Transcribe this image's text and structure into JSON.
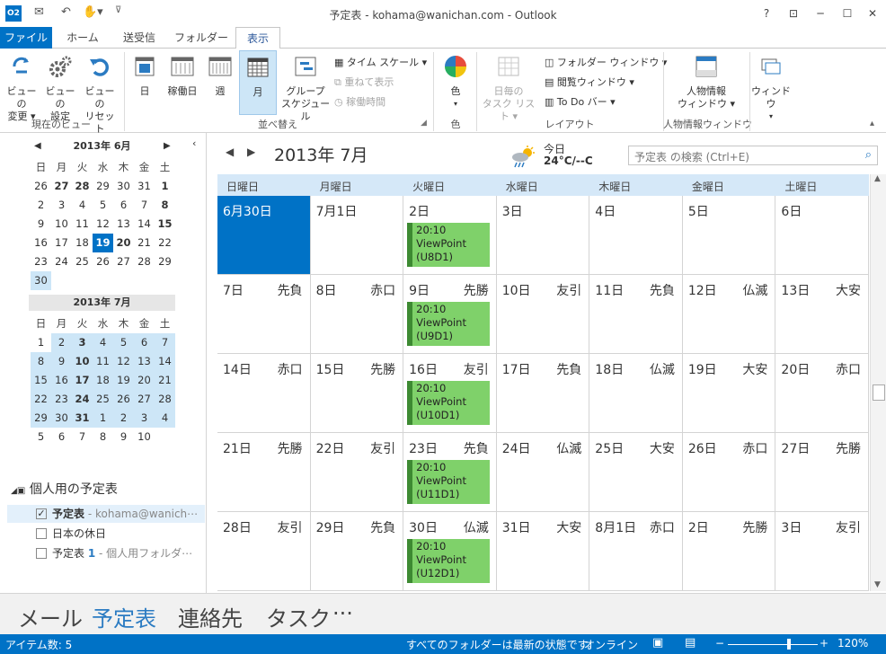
{
  "window": {
    "title": "予定表 - kohama@wanichan.com - Outlook",
    "app_icon": "O2",
    "help": "?",
    "restore_ribbon": "⊡",
    "minimize": "─",
    "maximize": "☐",
    "close": "✕",
    "qat_customize": "⊽"
  },
  "tabs": [
    "ファイル",
    "ホーム",
    "送受信",
    "フォルダー",
    "表示"
  ],
  "ribbon": {
    "current_view": {
      "label": "現在のビュー",
      "change": [
        "ビューの",
        "変更 ▾"
      ],
      "settings": [
        "ビューの",
        "設定"
      ],
      "reset": [
        "ビューの",
        "リセット"
      ]
    },
    "arrange": {
      "label": "並べ替え",
      "day": "日",
      "work_week": "稼働日",
      "week": "週",
      "month": "月",
      "schedule": [
        "グループ",
        "スケジュール"
      ],
      "time_scale": "タイム スケール ▾",
      "overlay": "重ねて表示",
      "working_hours": "稼働時間"
    },
    "color": {
      "label": "色",
      "btn": "色"
    },
    "layout": {
      "label": "レイアウト",
      "daily_task": [
        "日毎の",
        "タスク リスト ▾"
      ],
      "folder_pane": "フォルダー ウィンドウ ▾",
      "reading_pane": "閲覧ウィンドウ ▾",
      "todo_bar": "To Do バー ▾"
    },
    "people": {
      "label": "人物情報ウィンドウ",
      "btn": [
        "人物情報",
        "ウィンドウ ▾"
      ]
    },
    "window": {
      "btn": "ウィンドウ"
    }
  },
  "mini_cal": {
    "dow": [
      "日",
      "月",
      "火",
      "水",
      "木",
      "金",
      "土"
    ],
    "june": {
      "title": "2013年 6月",
      "days": [
        "26",
        "27",
        "28",
        "29",
        "30",
        "31",
        "1",
        "2",
        "3",
        "4",
        "5",
        "6",
        "7",
        "8",
        "9",
        "10",
        "11",
        "12",
        "13",
        "14",
        "15",
        "16",
        "17",
        "18",
        "19",
        "20",
        "21",
        "22",
        "23",
        "24",
        "25",
        "26",
        "27",
        "28",
        "29",
        "30"
      ]
    },
    "july": {
      "title": "2013年 7月",
      "days": [
        "1",
        "2",
        "3",
        "4",
        "5",
        "6",
        "7",
        "8",
        "9",
        "10",
        "11",
        "12",
        "13",
        "14",
        "15",
        "16",
        "17",
        "18",
        "19",
        "20",
        "21",
        "22",
        "23",
        "24",
        "25",
        "26",
        "27",
        "28",
        "29",
        "30",
        "31",
        "1",
        "2",
        "3",
        "4",
        "5",
        "6",
        "7",
        "8",
        "9",
        "10"
      ]
    }
  },
  "folders": {
    "group": "個人用の予定表",
    "items": [
      {
        "check": "✓",
        "name": "予定表",
        "sub": " - kohama@wanich⋯"
      },
      {
        "check": "",
        "name": "日本の休日",
        "sub": ""
      },
      {
        "check": "",
        "name": "予定表",
        "count": "1",
        "sub": " - 個人用フォルダ⋯"
      }
    ]
  },
  "calendar": {
    "title": "2013年 7月",
    "weather": {
      "label": "今日",
      "temp": "24°C/--C"
    },
    "search_placeholder": "予定表 の検索 (Ctrl+E)",
    "dow": [
      "日曜日",
      "月曜日",
      "火曜日",
      "水曜日",
      "木曜日",
      "金曜日",
      "土曜日"
    ],
    "weeks": [
      [
        {
          "d": "6月30日",
          "r": ""
        },
        {
          "d": "7月1日",
          "r": ""
        },
        {
          "d": "2日",
          "r": "",
          "a": [
            "20:10",
            "ViewPoint",
            "(U8D1)"
          ]
        },
        {
          "d": "3日",
          "r": ""
        },
        {
          "d": "4日",
          "r": ""
        },
        {
          "d": "5日",
          "r": ""
        },
        {
          "d": "6日",
          "r": ""
        }
      ],
      [
        {
          "d": "7日",
          "r": "先負"
        },
        {
          "d": "8日",
          "r": "赤口"
        },
        {
          "d": "9日",
          "r": "先勝",
          "a": [
            "20:10",
            "ViewPoint",
            "(U9D1)"
          ]
        },
        {
          "d": "10日",
          "r": "友引"
        },
        {
          "d": "11日",
          "r": "先負"
        },
        {
          "d": "12日",
          "r": "仏滅"
        },
        {
          "d": "13日",
          "r": "大安"
        }
      ],
      [
        {
          "d": "14日",
          "r": "赤口"
        },
        {
          "d": "15日",
          "r": "先勝"
        },
        {
          "d": "16日",
          "r": "友引",
          "a": [
            "20:10",
            "ViewPoint",
            "(U10D1)"
          ]
        },
        {
          "d": "17日",
          "r": "先負"
        },
        {
          "d": "18日",
          "r": "仏滅"
        },
        {
          "d": "19日",
          "r": "大安"
        },
        {
          "d": "20日",
          "r": "赤口"
        }
      ],
      [
        {
          "d": "21日",
          "r": "先勝"
        },
        {
          "d": "22日",
          "r": "友引"
        },
        {
          "d": "23日",
          "r": "先負",
          "a": [
            "20:10",
            "ViewPoint",
            "(U11D1)"
          ]
        },
        {
          "d": "24日",
          "r": "仏滅"
        },
        {
          "d": "25日",
          "r": "大安"
        },
        {
          "d": "26日",
          "r": "赤口"
        },
        {
          "d": "27日",
          "r": "先勝"
        }
      ],
      [
        {
          "d": "28日",
          "r": "友引"
        },
        {
          "d": "29日",
          "r": "先負"
        },
        {
          "d": "30日",
          "r": "仏滅",
          "a": [
            "20:10",
            "ViewPoint",
            "(U12D1)"
          ]
        },
        {
          "d": "31日",
          "r": "大安"
        },
        {
          "d": "8月1日",
          "r": "赤口"
        },
        {
          "d": "2日",
          "r": "先勝"
        },
        {
          "d": "3日",
          "r": "友引"
        }
      ]
    ]
  },
  "bottom_nav": [
    "メール",
    "予定表",
    "連絡先",
    "タスク",
    "···"
  ],
  "status": {
    "items": "アイテム数: 5",
    "sync": "すべてのフォルダーは最新の状態です。",
    "online": "オンライン",
    "zoom": "120%"
  },
  "colors": {
    "accent": "#0072c6",
    "appt": "#7fd16a",
    "appt_border": "#3d8a32",
    "dow_bar": "#d5e8f8"
  }
}
